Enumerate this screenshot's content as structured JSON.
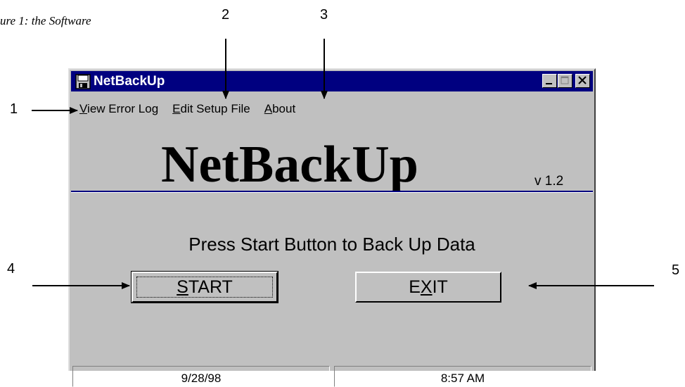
{
  "figure_caption": "ure 1: the Software",
  "callouts": [
    "1",
    "2",
    "3",
    "4",
    "5"
  ],
  "window": {
    "title": "NetBackUp",
    "app_icon": "floppy-disk-icon",
    "controls": [
      "minimize-icon",
      "maximize-icon",
      "close-icon"
    ]
  },
  "menu": {
    "view_error_log": {
      "mnemonic": "V",
      "rest": "iew Error Log"
    },
    "edit_setup_file": {
      "mnemonic": "E",
      "rest": "dit Setup File"
    },
    "about": {
      "mnemonic": "A",
      "rest": "bout"
    }
  },
  "logo": {
    "name": "NetBackUp",
    "version": "v 1.2"
  },
  "prompt": "Press Start Button to Back Up Data",
  "buttons": {
    "start": {
      "mnemonic": "S",
      "rest": "TART"
    },
    "exit": {
      "before": "E",
      "mnemonic": "X",
      "after": "IT"
    }
  },
  "status": {
    "date": "9/28/98",
    "time": "8:57 AM"
  },
  "colors": {
    "titlebar": "#000080",
    "face": "#c0c0c0",
    "rule": "#000080"
  }
}
